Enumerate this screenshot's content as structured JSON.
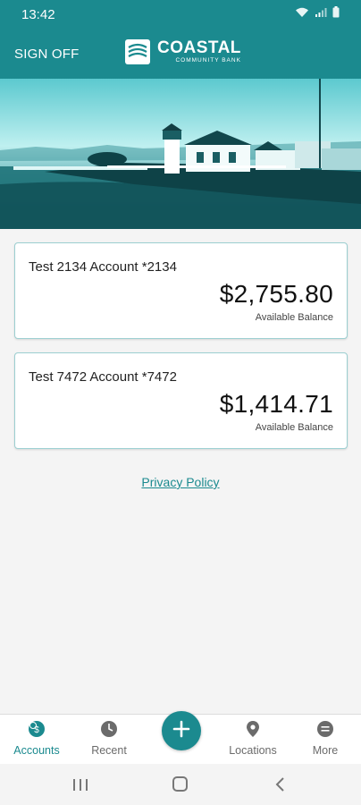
{
  "status_bar": {
    "time": "13:42"
  },
  "header": {
    "sign_off_label": "SIGN OFF",
    "logo_name": "COASTAL",
    "logo_sub": "COMMUNITY BANK"
  },
  "accounts": [
    {
      "name": "Test 2134 Account *2134",
      "balance": "$2,755.80",
      "balance_label": "Available Balance"
    },
    {
      "name": "Test 7472 Account *7472",
      "balance": "$1,414.71",
      "balance_label": "Available Balance"
    }
  ],
  "privacy_link": "Privacy Policy",
  "bottom_nav": {
    "items": [
      {
        "label": "Accounts",
        "icon": "dollar-circle-icon",
        "active": true
      },
      {
        "label": "Recent",
        "icon": "clock-icon",
        "active": false
      },
      {
        "label": "",
        "icon": "plus-icon",
        "active": false
      },
      {
        "label": "Locations",
        "icon": "map-pin-icon",
        "active": false
      },
      {
        "label": "More",
        "icon": "menu-circle-icon",
        "active": false
      }
    ]
  },
  "colors": {
    "brand": "#1b8a8f",
    "nav_inactive": "#6b6b6b",
    "background": "#f4f4f4"
  }
}
